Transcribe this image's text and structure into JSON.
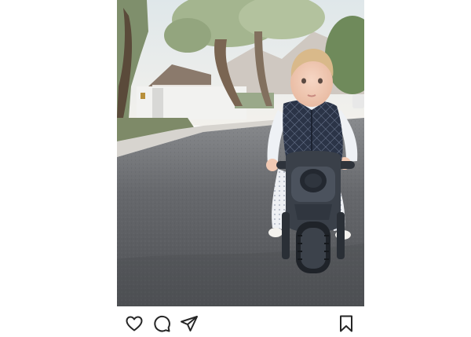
{
  "post": {
    "image": {
      "kind": "photo",
      "subject": "toddler-on-toy-motorbike-street",
      "colors": {
        "sky": "#e9eef0",
        "mountain": "#c9c3bd",
        "road": "#5f6164",
        "wall": "#f1f1f1",
        "vest": "#2b3447",
        "bike": "#343a44",
        "foliage": "#8fa07b"
      }
    },
    "actions": {
      "like_icon": "heart-icon",
      "comment_icon": "comment-icon",
      "share_icon": "paper-plane-icon",
      "save_icon": "bookmark-icon",
      "icon_color": "#262626"
    }
  }
}
